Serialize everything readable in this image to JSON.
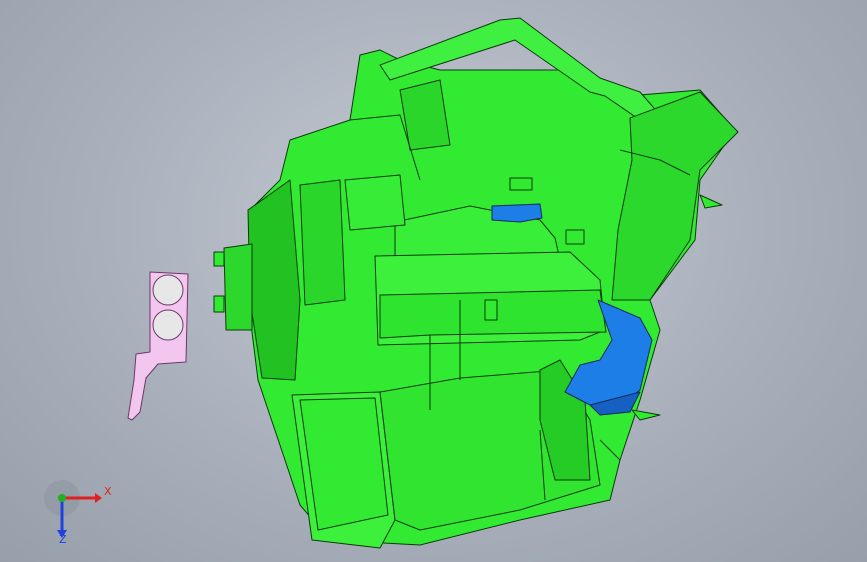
{
  "viewport": {
    "model_colors": {
      "housing": "#33ea33",
      "housing_shade": "#22c222",
      "edge": "#0c3a0c",
      "blower_blue": "#1e7ee8",
      "bracket": "#f2c6ee"
    }
  },
  "triad": {
    "x_label": "X",
    "z_label": "Z",
    "x_color": "#e02020",
    "y_color": "#20b020",
    "z_color": "#2040e0"
  }
}
